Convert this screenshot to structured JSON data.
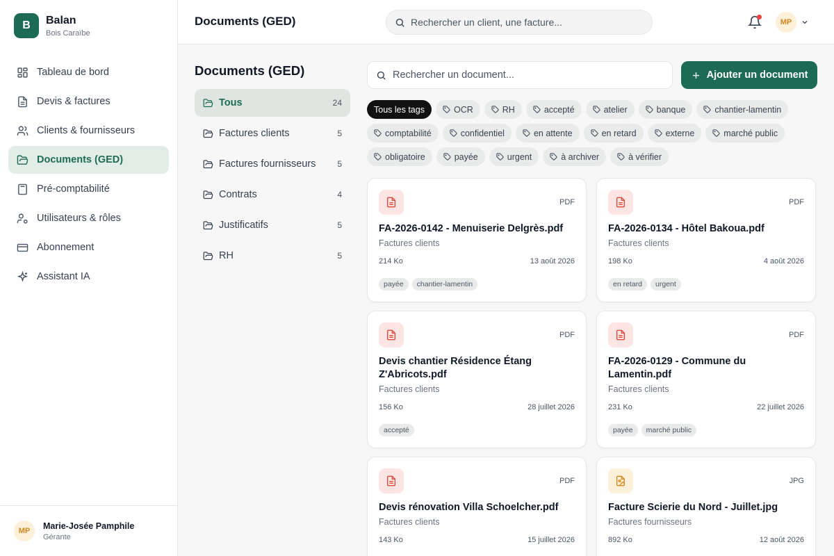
{
  "brand": {
    "logo_letter": "B",
    "name": "Balan",
    "subtitle": "Bois Caraïbe"
  },
  "nav": [
    {
      "label": "Tableau de bord",
      "icon": "dashboard-icon"
    },
    {
      "label": "Devis & factures",
      "icon": "document-icon"
    },
    {
      "label": "Clients & fournisseurs",
      "icon": "users-icon"
    },
    {
      "label": "Documents (GED)",
      "icon": "folder-icon",
      "active": true
    },
    {
      "label": "Pré-comptabilité",
      "icon": "calculator-icon"
    },
    {
      "label": "Utilisateurs & rôles",
      "icon": "user-cog-icon"
    },
    {
      "label": "Abonnement",
      "icon": "credit-card-icon"
    },
    {
      "label": "Assistant IA",
      "icon": "sparkles-icon"
    }
  ],
  "user": {
    "initials": "MP",
    "name": "Marie-Josée Pamphile",
    "role": "Gérante"
  },
  "header": {
    "title": "Documents (GED)",
    "search_placeholder": "Rechercher un client, une facture...",
    "avatar_initials": "MP"
  },
  "folders_panel": {
    "title": "Documents (GED)",
    "folders": [
      {
        "label": "Tous",
        "count": "24",
        "active": true
      },
      {
        "label": "Factures clients",
        "count": "5"
      },
      {
        "label": "Factures fournisseurs",
        "count": "5"
      },
      {
        "label": "Contrats",
        "count": "4"
      },
      {
        "label": "Justificatifs",
        "count": "5"
      },
      {
        "label": "RH",
        "count": "5"
      }
    ]
  },
  "documents": {
    "search_placeholder": "Rechercher un document...",
    "add_button_label": "Ajouter un document",
    "all_tags_label": "Tous les tags",
    "tags": [
      "OCR",
      "RH",
      "accepté",
      "atelier",
      "banque",
      "chantier-lamentin",
      "comptabilité",
      "confidentiel",
      "en attente",
      "en retard",
      "externe",
      "marché public",
      "obligatoire",
      "payée",
      "urgent",
      "à archiver",
      "à vérifier"
    ],
    "cards": [
      {
        "type": "PDF",
        "title": "FA-2026-0142 - Menuiserie Delgrès.pdf",
        "folder": "Factures clients",
        "size": "214 Ko",
        "date": "13 août 2026",
        "tags": [
          "payée",
          "chantier-lamentin"
        ]
      },
      {
        "type": "PDF",
        "title": "FA-2026-0134 - Hôtel Bakoua.pdf",
        "folder": "Factures clients",
        "size": "198 Ko",
        "date": "4 août 2026",
        "tags": [
          "en retard",
          "urgent"
        ]
      },
      {
        "type": "PDF",
        "title": "Devis chantier Résidence Étang Z'Abricots.pdf",
        "folder": "Factures clients",
        "size": "156 Ko",
        "date": "28 juillet 2026",
        "tags": [
          "accepté"
        ]
      },
      {
        "type": "PDF",
        "title": "FA-2026-0129 - Commune du Lamentin.pdf",
        "folder": "Factures clients",
        "size": "231 Ko",
        "date": "22 juillet 2026",
        "tags": [
          "payée",
          "marché public"
        ]
      },
      {
        "type": "PDF",
        "title": "Devis rénovation Villa Schoelcher.pdf",
        "folder": "Factures clients",
        "size": "143 Ko",
        "date": "15 juillet 2026",
        "tags": []
      },
      {
        "type": "JPG",
        "title": "Facture Scierie du Nord - Juillet.jpg",
        "folder": "Factures fournisseurs",
        "size": "892 Ko",
        "date": "12 août 2026",
        "tags": []
      }
    ]
  },
  "colors": {
    "accent": "#1d6b55",
    "pdf_icon": "#dc4a3d",
    "jpg_icon": "#d4861f",
    "notification": "#ef4444"
  }
}
